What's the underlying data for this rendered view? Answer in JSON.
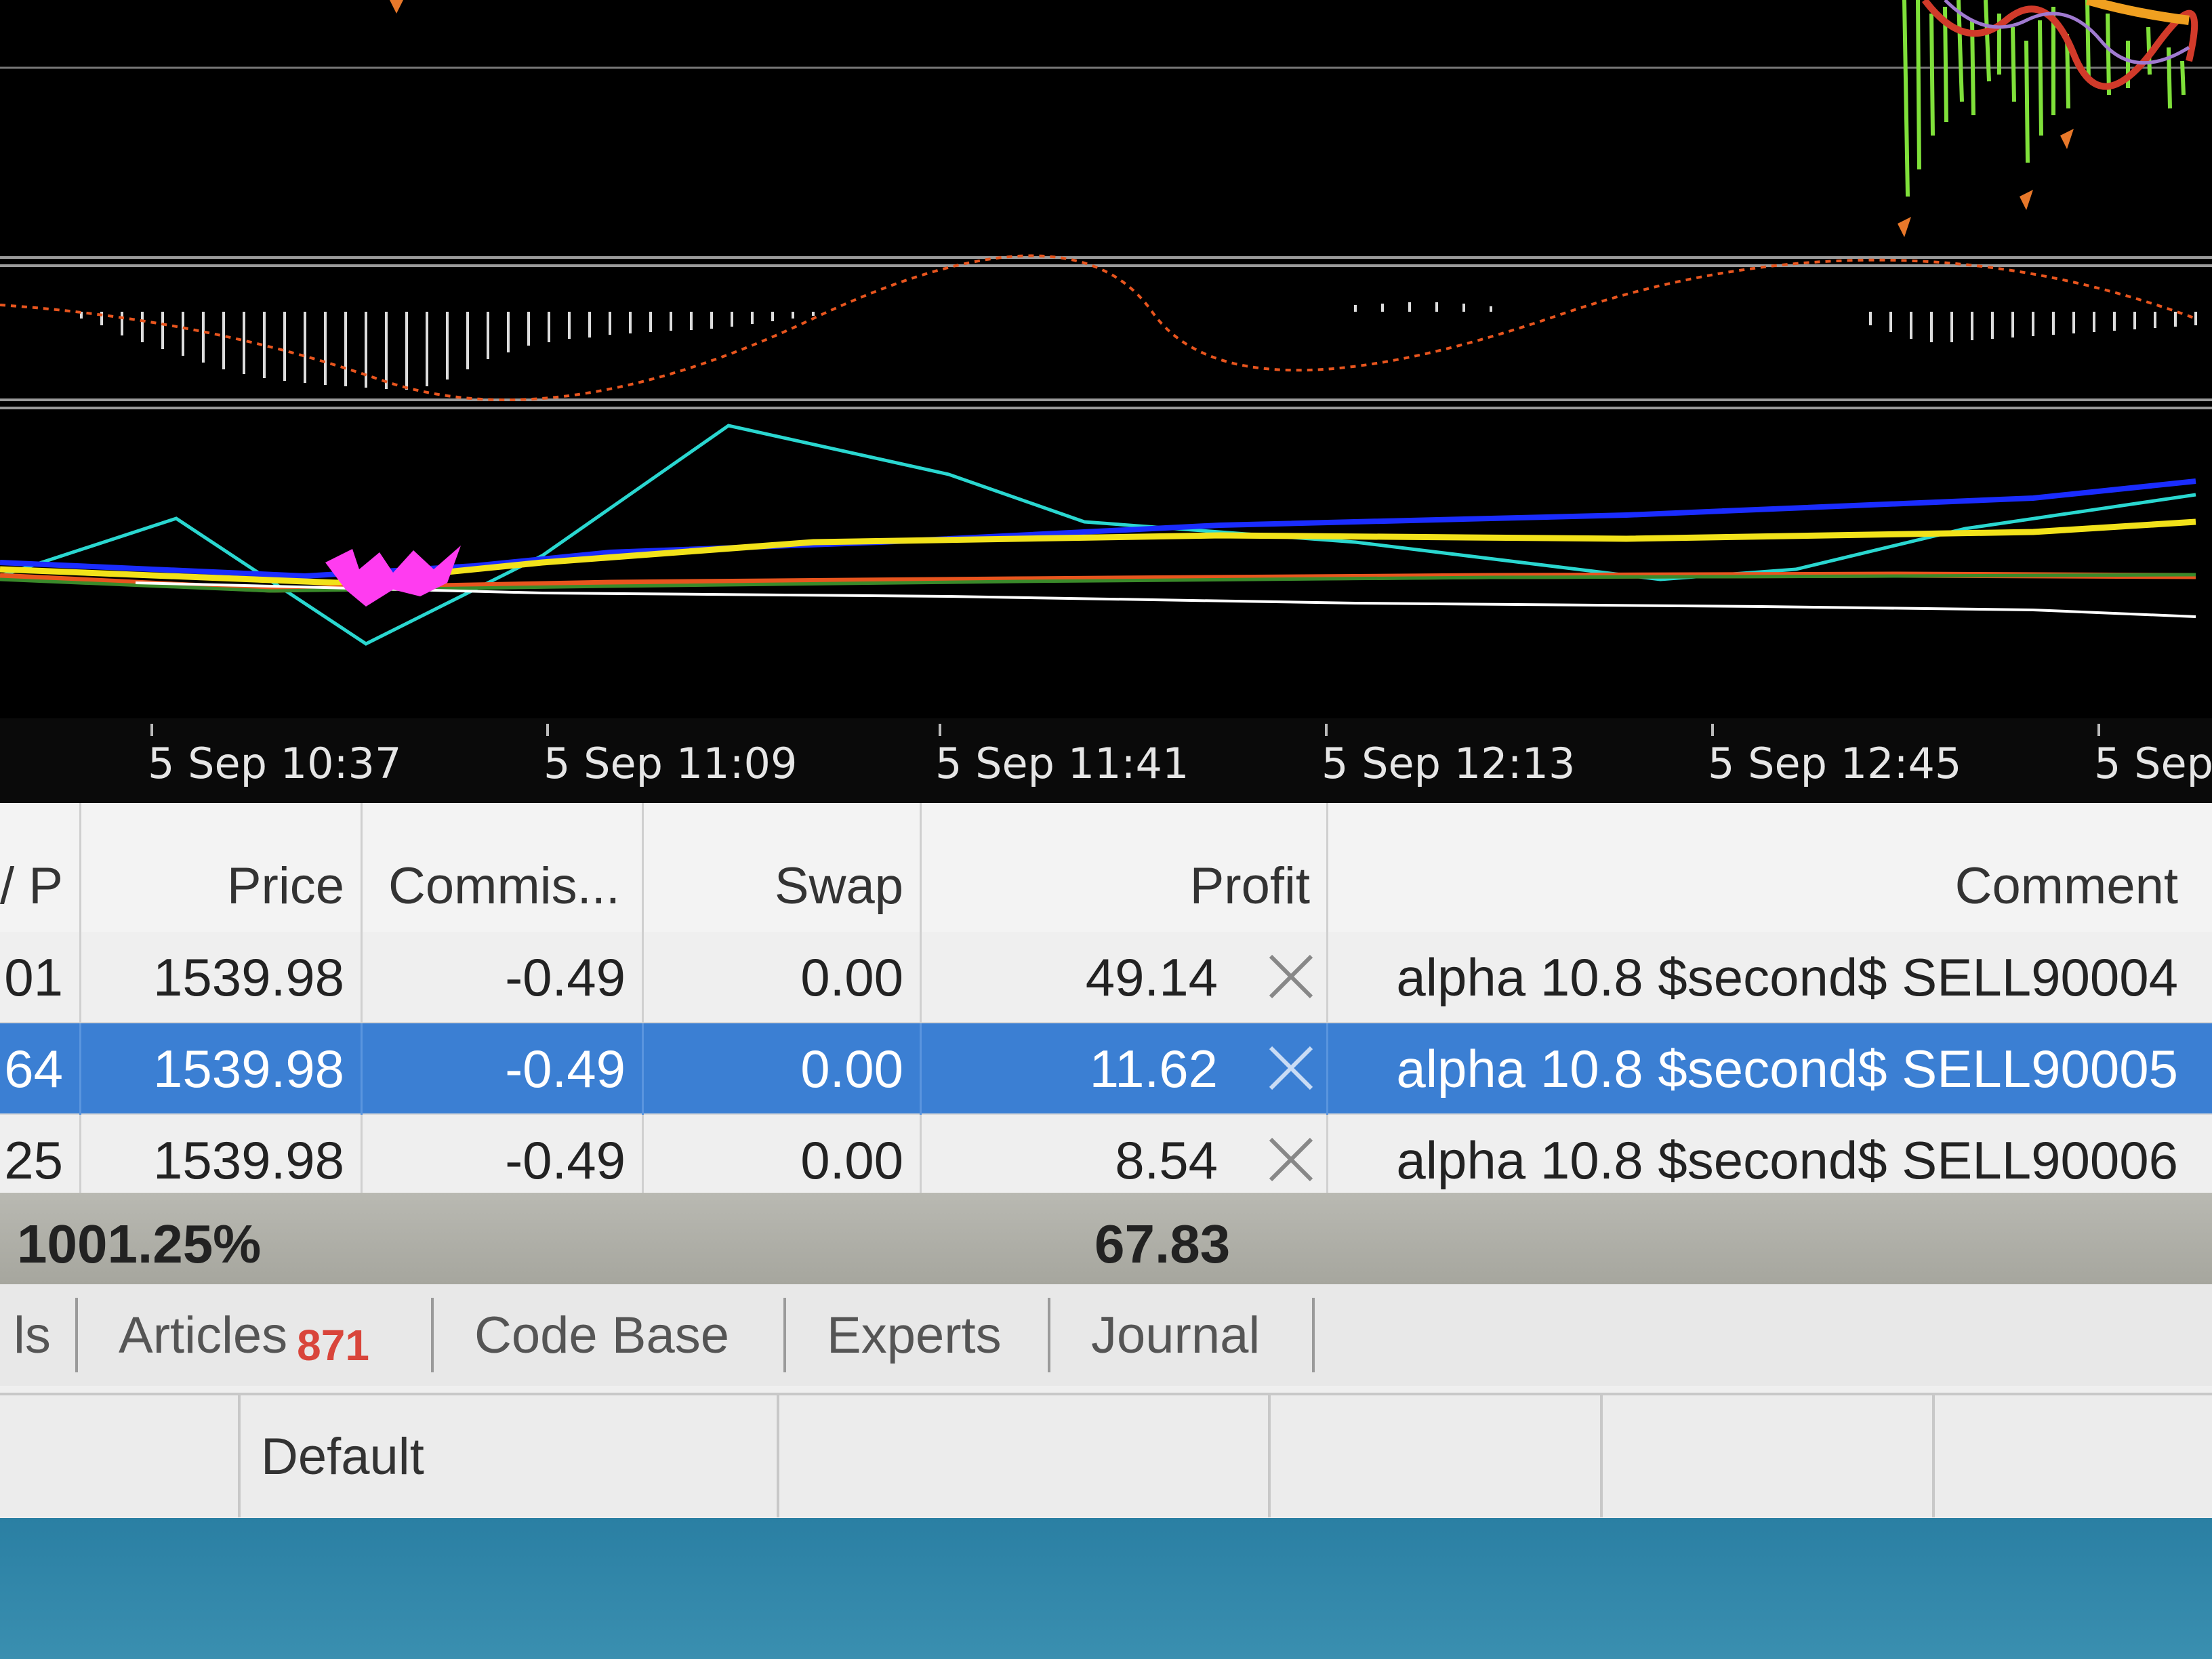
{
  "time_axis": [
    "5 Sep 10:37",
    "5 Sep 11:09",
    "5 Sep 11:41",
    "5 Sep 12:13",
    "5 Sep 12:45",
    "5 Sep"
  ],
  "table": {
    "columns": [
      "/ P",
      "Price",
      "Commis...",
      "Swap",
      "Profit",
      "Comment"
    ],
    "rows": [
      {
        "tp": ".01",
        "price": "1539.98",
        "commission": "-0.49",
        "swap": "0.00",
        "profit": "49.14",
        "comment": "alpha 10.8 $second$ SELL90004",
        "selected": false
      },
      {
        "tp": ".64",
        "price": "1539.98",
        "commission": "-0.49",
        "swap": "0.00",
        "profit": "11.62",
        "comment": "alpha 10.8 $second$ SELL90005",
        "selected": true
      },
      {
        "tp": ".25",
        "price": "1539.98",
        "commission": "-0.49",
        "swap": "0.00",
        "profit": "8.54",
        "comment": "alpha 10.8 $second$ SELL90006",
        "selected": false
      }
    ],
    "total_margin_level": "1001.25%",
    "total_profit": "67.83"
  },
  "tabs": [
    {
      "label": "ls"
    },
    {
      "label": "Articles",
      "badge": "871"
    },
    {
      "label": "Code Base"
    },
    {
      "label": "Experts"
    },
    {
      "label": "Journal"
    }
  ],
  "status_bar": {
    "profile": "Default"
  },
  "icons": {
    "close_position": "close-x-icon"
  },
  "colors": {
    "selection": "#3b7fd3",
    "badge": "#d9453b",
    "accent_lines": [
      "#2ad7d0",
      "#1a2cff",
      "#f2e21a",
      "#e8551e",
      "#ff3cf0",
      "#7fe03a"
    ]
  }
}
